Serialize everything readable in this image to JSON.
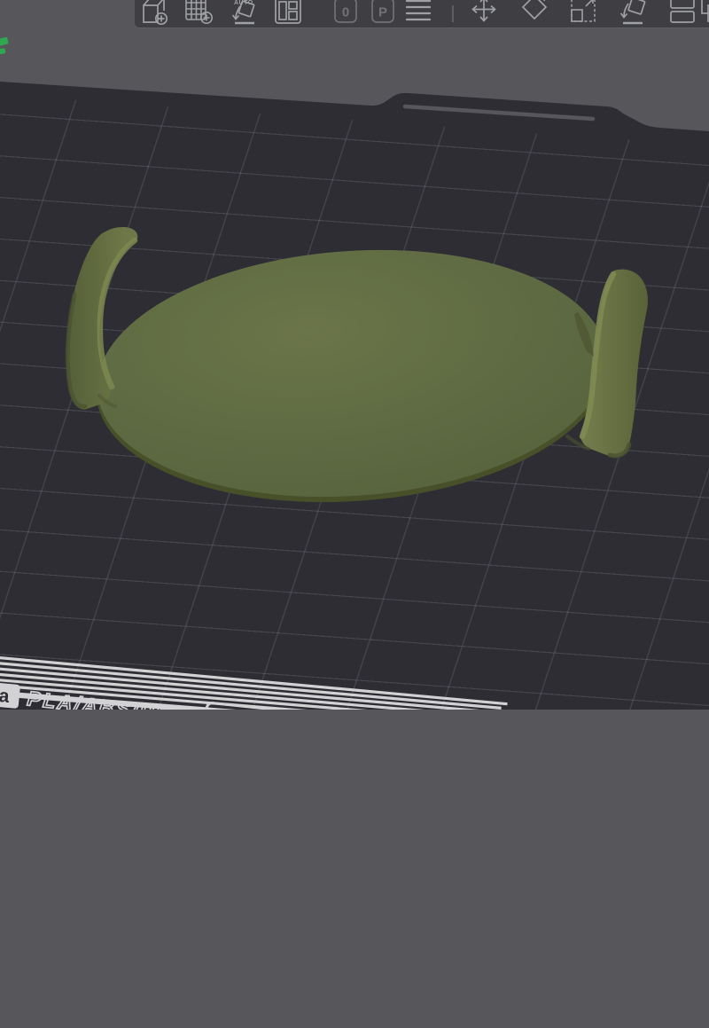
{
  "toolbar": {
    "items": [
      {
        "name": "add-object"
      },
      {
        "name": "add-plate"
      },
      {
        "name": "auto-arrange",
        "label": "AUTO"
      },
      {
        "name": "split-layout"
      },
      {
        "name": "badge-zero",
        "label": "0",
        "disabled": true
      },
      {
        "name": "badge-p",
        "label": "P",
        "disabled": true
      },
      {
        "name": "layers-list"
      },
      {
        "name": "move"
      },
      {
        "name": "rotate"
      },
      {
        "name": "scale"
      },
      {
        "name": "place-on-face"
      },
      {
        "name": "split-to-objects"
      },
      {
        "name": "split-to-parts"
      }
    ]
  },
  "viewport": {
    "plate_material_text": "PLA/ABS/PETG",
    "plate_logo_glyph": "a"
  },
  "colors": {
    "background": "#57575b",
    "toolbar_bg": "#3e3e43",
    "icon_stroke": "#9fa1a5",
    "plate": "#2d2d33",
    "grid_line": "#45454c",
    "model_olive": "#5d6941",
    "model_highlight": "#7d8850",
    "accent_green": "#2fa84f",
    "marking_white": "#d2d2d4"
  }
}
